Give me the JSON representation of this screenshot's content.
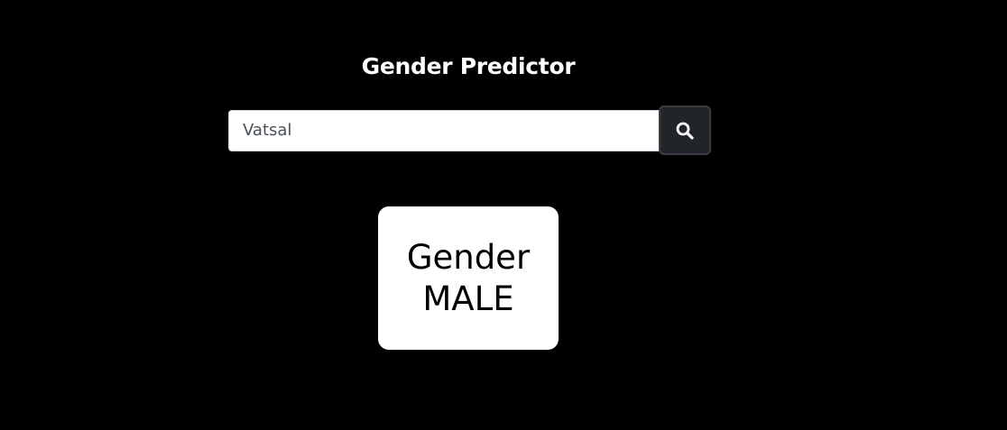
{
  "header": {
    "title": "Gender Predictor"
  },
  "search": {
    "value": "Vatsal",
    "placeholder": "",
    "button_icon": "search-icon"
  },
  "result": {
    "label": "Gender",
    "value": "MALE"
  },
  "colors": {
    "background": "#000000",
    "button": "#212529",
    "card": "#ffffff",
    "title_text": "#ffffff"
  }
}
